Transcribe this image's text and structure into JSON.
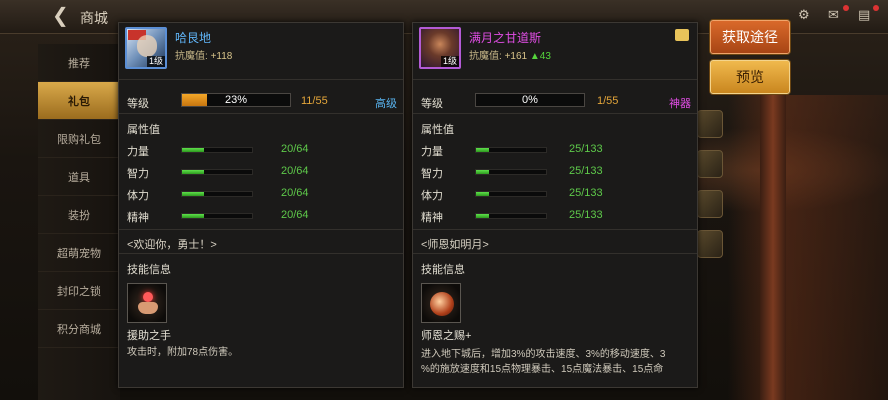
{
  "top_bar": {
    "title": "商城"
  },
  "nav": {
    "items": [
      {
        "label": "推荐"
      },
      {
        "label": "礼包",
        "active": true
      },
      {
        "label": "限购礼包"
      },
      {
        "label": "道具"
      },
      {
        "label": "装扮"
      },
      {
        "label": "超萌宠物"
      },
      {
        "label": "封印之锁"
      },
      {
        "label": "积分商城"
      }
    ]
  },
  "actions": {
    "get_label": "获取途径",
    "preview_label": "预览"
  },
  "left_card": {
    "name": "哈艮地",
    "sub_label": "抗魔值:",
    "sub_value": "+118",
    "avatar_level": "1级",
    "level_label": "等级",
    "level_percent_text": "23%",
    "level_fill": 0.23,
    "level_count": "11/55",
    "grade": "高级",
    "attr_title": "属性值",
    "stats": [
      {
        "label": "力量",
        "value": "20/64",
        "fill": 0.31
      },
      {
        "label": "智力",
        "value": "20/64",
        "fill": 0.31
      },
      {
        "label": "体力",
        "value": "20/64",
        "fill": 0.31
      },
      {
        "label": "精神",
        "value": "20/64",
        "fill": 0.31
      }
    ],
    "quote": "<欢迎你，勇士！>",
    "skill_title": "技能信息",
    "skill_name": "援助之手",
    "skill_desc": "攻击时，附加78点伤害。"
  },
  "right_card": {
    "name": "满月之甘道斯",
    "sub_label": "抗魔值:",
    "sub_value": "+161",
    "sub_bonus": "▲43",
    "avatar_level": "1级",
    "level_label": "等级",
    "level_percent_text": "0%",
    "level_fill": 0.0,
    "level_count": "1/55",
    "grade": "神器",
    "attr_title": "属性值",
    "stats": [
      {
        "label": "力量",
        "value": "25/133",
        "fill": 0.19
      },
      {
        "label": "智力",
        "value": "25/133",
        "fill": 0.19
      },
      {
        "label": "体力",
        "value": "25/133",
        "fill": 0.19
      },
      {
        "label": "精神",
        "value": "25/133",
        "fill": 0.19
      }
    ],
    "quote": "<师恩如明月>",
    "skill_title": "技能信息",
    "skill_name": "师恩之赐+",
    "skill_desc_1": "进入地下城后，增加3%的攻击速度、3%的移动速度、3",
    "skill_desc_2": "%的施放速度和15点物理暴击、15点魔法暴击、15点命"
  },
  "colors": {
    "accent_gold": "#e4a63a",
    "stat_green": "#5ec94a",
    "grade_blue": "#59b4f0",
    "grade_purple": "#e04de4"
  }
}
